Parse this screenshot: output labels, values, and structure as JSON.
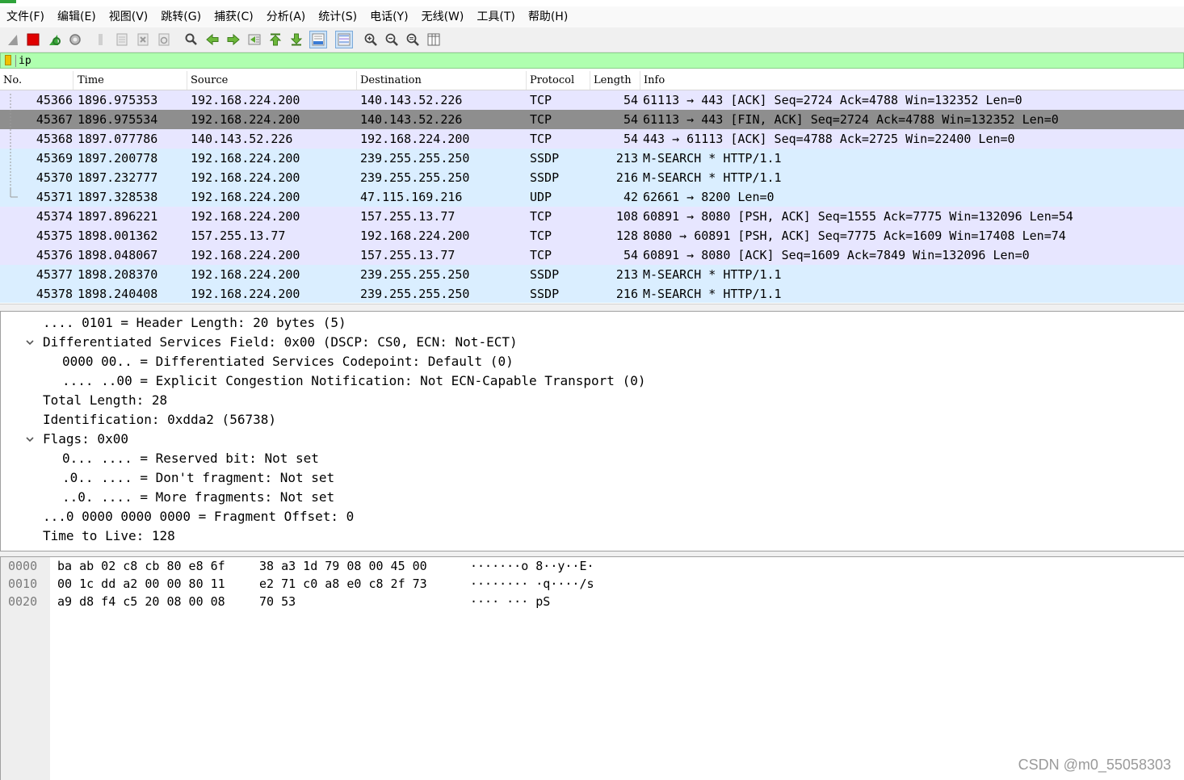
{
  "menu": [
    "文件(F)",
    "编辑(E)",
    "视图(V)",
    "跳转(G)",
    "捕获(C)",
    "分析(A)",
    "统计(S)",
    "电话(Y)",
    "无线(W)",
    "工具(T)",
    "帮助(H)"
  ],
  "toolbar": {
    "icons": [
      "shark-fin-start-icon",
      "stop-capture-icon",
      "restart-capture-icon",
      "capture-options-icon",
      "open-file-icon",
      "save-file-icon",
      "close-file-icon",
      "reload-file-icon",
      "find-packet-icon",
      "go-back-icon",
      "go-forward-icon",
      "go-to-packet-icon",
      "first-packet-icon",
      "last-packet-icon",
      "autoscroll-icon",
      "colorize-icon",
      "zoom-in-icon",
      "zoom-out-icon",
      "normal-size-icon",
      "resize-columns-icon"
    ]
  },
  "filter": {
    "value": "ip"
  },
  "packet_list": {
    "columns": [
      "No.",
      "Time",
      "Source",
      "Destination",
      "Protocol",
      "Length",
      "Info"
    ],
    "rows": [
      {
        "no": "45366",
        "time": "1896.975353",
        "src": "192.168.224.200",
        "dst": "140.143.52.226",
        "proto": "TCP",
        "len": "54",
        "info": "61113 → 443 [ACK] Seq=2724 Ack=4788 Win=132352 Len=0",
        "style": "tcp"
      },
      {
        "no": "45367",
        "time": "1896.975534",
        "src": "192.168.224.200",
        "dst": "140.143.52.226",
        "proto": "TCP",
        "len": "54",
        "info": "61113 → 443 [FIN, ACK] Seq=2724 Ack=4788 Win=132352 Len=0",
        "style": "selected"
      },
      {
        "no": "45368",
        "time": "1897.077786",
        "src": "140.143.52.226",
        "dst": "192.168.224.200",
        "proto": "TCP",
        "len": "54",
        "info": "443 → 61113 [ACK] Seq=4788 Ack=2725 Win=22400 Len=0",
        "style": "tcp"
      },
      {
        "no": "45369",
        "time": "1897.200778",
        "src": "192.168.224.200",
        "dst": "239.255.255.250",
        "proto": "SSDP",
        "len": "213",
        "info": "M-SEARCH * HTTP/1.1",
        "style": "udp"
      },
      {
        "no": "45370",
        "time": "1897.232777",
        "src": "192.168.224.200",
        "dst": "239.255.255.250",
        "proto": "SSDP",
        "len": "216",
        "info": "M-SEARCH * HTTP/1.1",
        "style": "udp"
      },
      {
        "no": "45371",
        "time": "1897.328538",
        "src": "192.168.224.200",
        "dst": "47.115.169.216",
        "proto": "UDP",
        "len": "42",
        "info": "62661 → 8200 Len=0",
        "style": "udp"
      },
      {
        "no": "45374",
        "time": "1897.896221",
        "src": "192.168.224.200",
        "dst": "157.255.13.77",
        "proto": "TCP",
        "len": "108",
        "info": "60891 → 8080 [PSH, ACK] Seq=1555 Ack=7775 Win=132096 Len=54",
        "style": "tcp"
      },
      {
        "no": "45375",
        "time": "1898.001362",
        "src": "157.255.13.77",
        "dst": "192.168.224.200",
        "proto": "TCP",
        "len": "128",
        "info": "8080 → 60891 [PSH, ACK] Seq=7775 Ack=1609 Win=17408 Len=74",
        "style": "tcp"
      },
      {
        "no": "45376",
        "time": "1898.048067",
        "src": "192.168.224.200",
        "dst": "157.255.13.77",
        "proto": "TCP",
        "len": "54",
        "info": "60891 → 8080 [ACK] Seq=1609 Ack=7849 Win=132096 Len=0",
        "style": "tcp"
      },
      {
        "no": "45377",
        "time": "1898.208370",
        "src": "192.168.224.200",
        "dst": "239.255.255.250",
        "proto": "SSDP",
        "len": "213",
        "info": "M-SEARCH * HTTP/1.1",
        "style": "udp"
      },
      {
        "no": "45378",
        "time": "1898.240408",
        "src": "192.168.224.200",
        "dst": "239.255.255.250",
        "proto": "SSDP",
        "len": "216",
        "info": "M-SEARCH * HTTP/1.1",
        "style": "udp"
      }
    ]
  },
  "details": [
    {
      "text": ".... 0101 = Header Length: 20 bytes (5)",
      "indent": 1,
      "expander": false
    },
    {
      "text": "Differentiated Services Field: 0x00 (DSCP: CS0, ECN: Not-ECT)",
      "indent": 1,
      "expander": true
    },
    {
      "text": "0000 00.. = Differentiated Services Codepoint: Default (0)",
      "indent": 2,
      "expander": false
    },
    {
      "text": ".... ..00 = Explicit Congestion Notification: Not ECN-Capable Transport (0)",
      "indent": 2,
      "expander": false
    },
    {
      "text": "Total Length: 28",
      "indent": 1,
      "expander": false
    },
    {
      "text": "Identification: 0xdda2 (56738)",
      "indent": 1,
      "expander": false
    },
    {
      "text": "Flags: 0x00",
      "indent": 1,
      "expander": true
    },
    {
      "text": "0... .... = Reserved bit: Not set",
      "indent": 2,
      "expander": false
    },
    {
      "text": ".0.. .... = Don't fragment: Not set",
      "indent": 2,
      "expander": false
    },
    {
      "text": "..0. .... = More fragments: Not set",
      "indent": 2,
      "expander": false
    },
    {
      "text": "...0 0000 0000 0000 = Fragment Offset: 0",
      "indent": 1,
      "expander": false
    },
    {
      "text": "Time to Live: 128",
      "indent": 1,
      "expander": false
    }
  ],
  "bytes": [
    {
      "offset": "0000",
      "hex1": "ba ab 02 c8 cb 80 e8 6f",
      "hex2": "38 a3 1d 79 08 00 45 00",
      "ascii": "·······o 8··y··E·"
    },
    {
      "offset": "0010",
      "hex1": "00 1c dd a2 00 00 80 11",
      "hex2": "e2 71 c0 a8 e0 c8 2f 73",
      "ascii": "········ ·q····/s"
    },
    {
      "offset": "0020",
      "hex1": "a9 d8 f4 c5 20 08 00 08",
      "hex2": "70 53",
      "ascii": "···· ··· pS"
    }
  ],
  "watermark": "CSDN @m0_55058303",
  "colors": {
    "tcp_row": "#e7e6ff",
    "udp_row": "#daeeff",
    "selected_row": "#8e8e8e",
    "filter_valid": "#afffaf"
  }
}
